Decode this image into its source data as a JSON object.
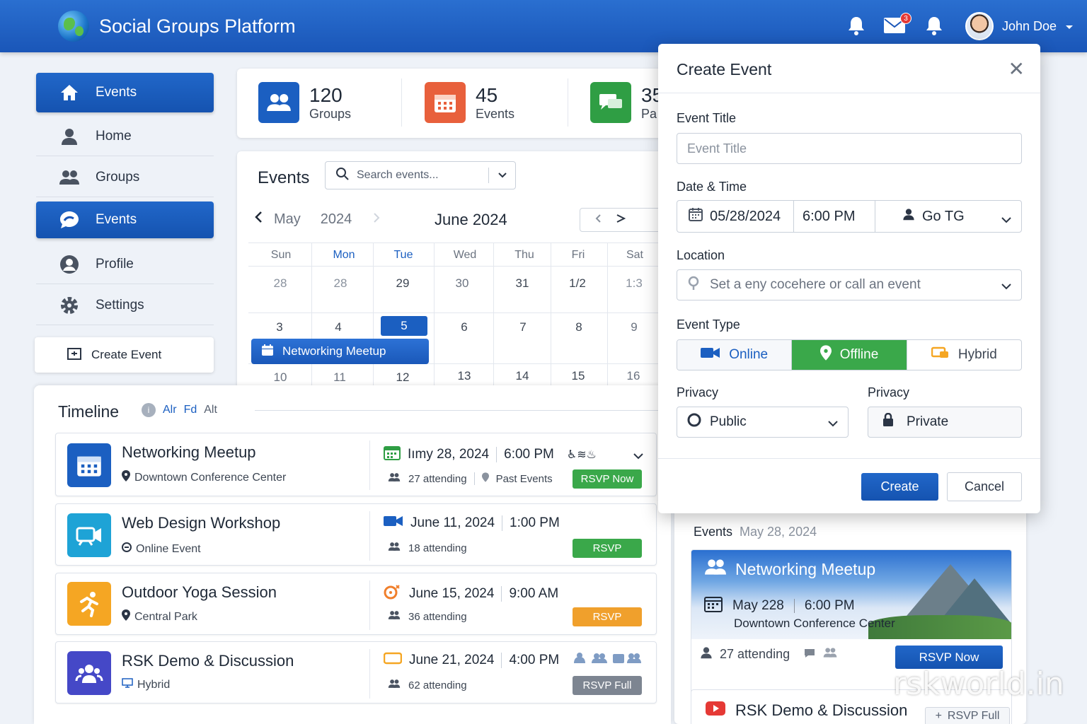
{
  "header": {
    "app_title": "Social Groups Platform",
    "mail_badge": "3",
    "user_name": "John Doe",
    "accent": "#1a56b8"
  },
  "sidebar": {
    "items": [
      {
        "label": "Events",
        "icon": "home-icon",
        "active": true
      },
      {
        "label": "Home",
        "icon": "user-icon",
        "active": false
      },
      {
        "label": "Groups",
        "icon": "groups-icon",
        "active": false
      },
      {
        "label": "Events",
        "icon": "chat-bubble-icon",
        "active": true
      },
      {
        "label": "Profile",
        "icon": "profile-icon",
        "active": false
      },
      {
        "label": "Settings",
        "icon": "gear-icon",
        "active": false
      }
    ],
    "create_label": "Create Event"
  },
  "stats": [
    {
      "value": "120",
      "label": "Groups",
      "color": "#1b5fc1"
    },
    {
      "value": "45",
      "label": "Events",
      "color": "#e8603c"
    },
    {
      "value": "35",
      "label": "Pa",
      "color": "#2f9e44"
    }
  ],
  "calendar": {
    "title": "Events",
    "search_placeholder": "Search events...",
    "prev_month": "May",
    "prev_year": "2024",
    "current": "June 2024",
    "weekdays": [
      "Sun",
      "Mon",
      "Tue",
      "Wed",
      "Thu",
      "Fri",
      "Sat"
    ],
    "weeks": [
      [
        "28",
        "28",
        "29",
        "30",
        "31",
        "1/2",
        "1:3"
      ],
      [
        "3",
        "4",
        "5",
        "6",
        "7",
        "8",
        "9"
      ],
      [
        "10",
        "11",
        "12",
        "13",
        "14",
        "15",
        "16"
      ]
    ],
    "event_label": "Networking Meetup"
  },
  "timeline": {
    "title": "Timeline",
    "filters": [
      "Alr",
      "Fd",
      "Alt"
    ],
    "items": [
      {
        "title": "Networking Meetup",
        "sub": "Downtown Conference Center",
        "date": "Iımy 28, 2024",
        "time": "6:00 PM",
        "attending": "27 attending",
        "extra": "Past Events",
        "rsvp": "RSVP Now",
        "rsvp_color": "#3aa84a",
        "color": "#1b5fc1"
      },
      {
        "title": "Web Design Workshop",
        "sub": "Online Event",
        "date": "June 11, 2024",
        "time": "1:00 PM",
        "attending": "18 attending",
        "extra": "",
        "rsvp": "RSVP",
        "rsvp_color": "#3aa84a",
        "color": "#1ea3d6"
      },
      {
        "title": "Outdoor Yoga Session",
        "sub": "Central Park",
        "date": "June 15, 2024",
        "time": "9:00 AM",
        "attending": "36 attending",
        "extra": "",
        "rsvp": "RSVP",
        "rsvp_color": "#f0a02c",
        "color": "#f5a623"
      },
      {
        "title": "RSK Demo & Discussion",
        "sub": "Hybrid",
        "date": "June 21, 2024",
        "time": "4:00 PM",
        "attending": "62 attending",
        "extra": "",
        "rsvp": "RSVP Full",
        "rsvp_color": "#7d8591",
        "color": "#4548c7"
      }
    ]
  },
  "modal": {
    "title": "Create Event",
    "title_label": "Event Title",
    "title_placeholder": "Event Title",
    "datetime_label": "Date & Time",
    "date": "05/28/2024",
    "time": "6:00 PM",
    "timezone": "Go TG",
    "location_label": "Location",
    "location_placeholder": "Set a eny cocehere or call an event",
    "type_label": "Event Type",
    "types": [
      "Online",
      "Offline",
      "Hybrid"
    ],
    "selected_type": "Offline",
    "privacy_label": "Privacy",
    "privacy_value": "Public",
    "privacy_label2": "Privacy",
    "privacy_value2": "Private",
    "create": "Create",
    "cancel": "Cancel"
  },
  "right_panel": {
    "head": "Events",
    "head_date": "May 28, 2024",
    "feature": {
      "title": "Networking Meetup",
      "date": "May 228",
      "time": "6:00 PM",
      "location": "Downtown Conference Center",
      "attending": "27 attending",
      "rsvp": "RSVP Now"
    },
    "second": {
      "title": "RSK Demo & Discussion",
      "rsvp": "RSVP Full"
    }
  },
  "watermark": "rskworld.in"
}
